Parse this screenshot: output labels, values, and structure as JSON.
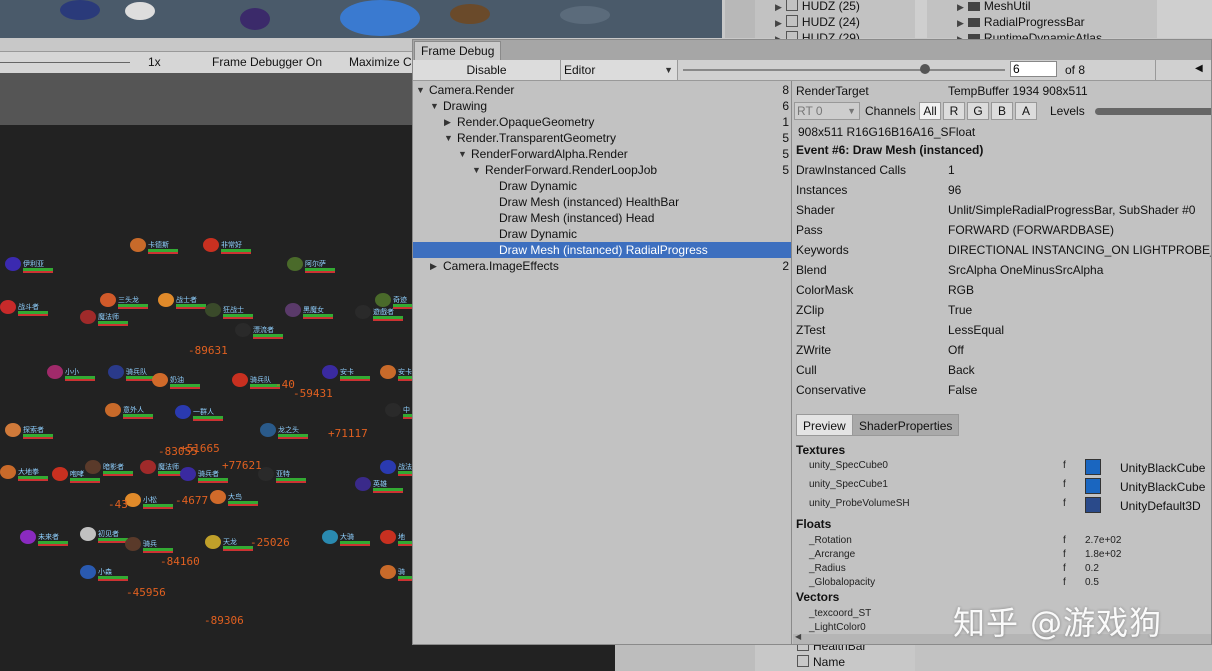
{
  "game_toolbar": {
    "scale": "1x",
    "frame_debugger": "Frame Debugger On",
    "maximize": "Maximize C"
  },
  "hierarchy_top": [
    {
      "label": "HUDZ (25)"
    },
    {
      "label": "HUDZ (24)"
    },
    {
      "label": "HUDZ (29)"
    }
  ],
  "project_top": [
    {
      "label": "MeshUtil"
    },
    {
      "label": "RadialProgressBar"
    },
    {
      "label": "RuntimeDynamicAtlas"
    }
  ],
  "hierarchy_bottom": [
    {
      "label": "HealthBar"
    },
    {
      "label": "Name"
    }
  ],
  "game_view": {
    "damage_numbers": [
      "-89631",
      "-59431",
      "+71117",
      "-83055",
      "+51665",
      "+77621",
      "-4677",
      "-43",
      "-25026",
      "-84160",
      "-45956",
      "-89306",
      "-40"
    ]
  },
  "frame_debug": {
    "tab": "Frame Debug",
    "disable_label": "Disable",
    "editor_dropdown": "Editor",
    "event_index": "6",
    "event_total": "of 8",
    "event_fraction": 0.75,
    "tree": [
      {
        "label": "Camera.Render",
        "count": "8",
        "expanded": true
      },
      {
        "label": "Drawing",
        "count": "6",
        "expanded": true
      },
      {
        "label": "Render.OpaqueGeometry",
        "count": "1",
        "expanded": false
      },
      {
        "label": "Render.TransparentGeometry",
        "count": "5",
        "expanded": true
      },
      {
        "label": "RenderForwardAlpha.Render",
        "count": "5",
        "expanded": true
      },
      {
        "label": "RenderForward.RenderLoopJob",
        "count": "5",
        "expanded": true
      },
      {
        "label": "Draw Dynamic",
        "count": ""
      },
      {
        "label": "Draw Mesh (instanced) HealthBar",
        "count": ""
      },
      {
        "label": "Draw Mesh (instanced) Head",
        "count": ""
      },
      {
        "label": "Draw Dynamic",
        "count": ""
      },
      {
        "label": "Draw Mesh (instanced) RadialProgress",
        "count": "",
        "selected": true
      },
      {
        "label": "Camera.ImageEffects",
        "count": "2",
        "expanded": false
      }
    ],
    "render_target_label": "RenderTarget",
    "render_target_value": "TempBuffer 1934 908x511",
    "rt_dropdown": "RT 0",
    "channels_label": "Channels",
    "channel_buttons": [
      "All",
      "R",
      "G",
      "B",
      "A"
    ],
    "levels_label": "Levels",
    "format_line": "908x511 R16G16B16A16_SFloat",
    "event_title": "Event #6: Draw Mesh (instanced)",
    "details": [
      {
        "key": "DrawInstanced Calls",
        "value": "1"
      },
      {
        "key": "Instances",
        "value": "96"
      },
      {
        "key": "Shader",
        "value": "Unlit/SimpleRadialProgressBar, SubShader #0"
      },
      {
        "key": "Pass",
        "value": "FORWARD (FORWARDBASE)"
      },
      {
        "key": "Keywords",
        "value": "DIRECTIONAL INSTANCING_ON LIGHTPROBE_"
      },
      {
        "key": "Blend",
        "value": "SrcAlpha OneMinusSrcAlpha"
      },
      {
        "key": "ColorMask",
        "value": "RGB"
      },
      {
        "key": "ZClip",
        "value": "True"
      },
      {
        "key": "ZTest",
        "value": "LessEqual"
      },
      {
        "key": "ZWrite",
        "value": "Off"
      },
      {
        "key": "Cull",
        "value": "Back"
      },
      {
        "key": "Conservative",
        "value": "False"
      }
    ],
    "tab_preview": "Preview",
    "tab_shader_properties": "ShaderProperties",
    "textures_header": "Textures",
    "textures": [
      {
        "name": "unity_SpecCube0",
        "type": "f",
        "value": "UnityBlackCube"
      },
      {
        "name": "unity_SpecCube1",
        "type": "f",
        "value": "UnityBlackCube"
      },
      {
        "name": "unity_ProbeVolumeSH",
        "type": "f",
        "value": "UnityDefault3D"
      }
    ],
    "floats_header": "Floats",
    "floats": [
      {
        "name": "_Rotation",
        "type": "f",
        "value": "2.7e+02"
      },
      {
        "name": "_Arcrange",
        "type": "f",
        "value": "1.8e+02"
      },
      {
        "name": "_Radius",
        "type": "f",
        "value": "0.2"
      },
      {
        "name": "_Globalopacity",
        "type": "f",
        "value": "0.5"
      }
    ],
    "vectors_header": "Vectors",
    "vectors": [
      {
        "name": "_texcoord_ST"
      },
      {
        "name": "_LightColor0"
      }
    ]
  },
  "watermark": "知乎 @游戏狗",
  "colors": {
    "selection": "#3d6fbf",
    "panel": "#c2c2c2",
    "game_bg": "#222222",
    "damage": "#e06020",
    "name_tag": "#8fd0ff"
  }
}
